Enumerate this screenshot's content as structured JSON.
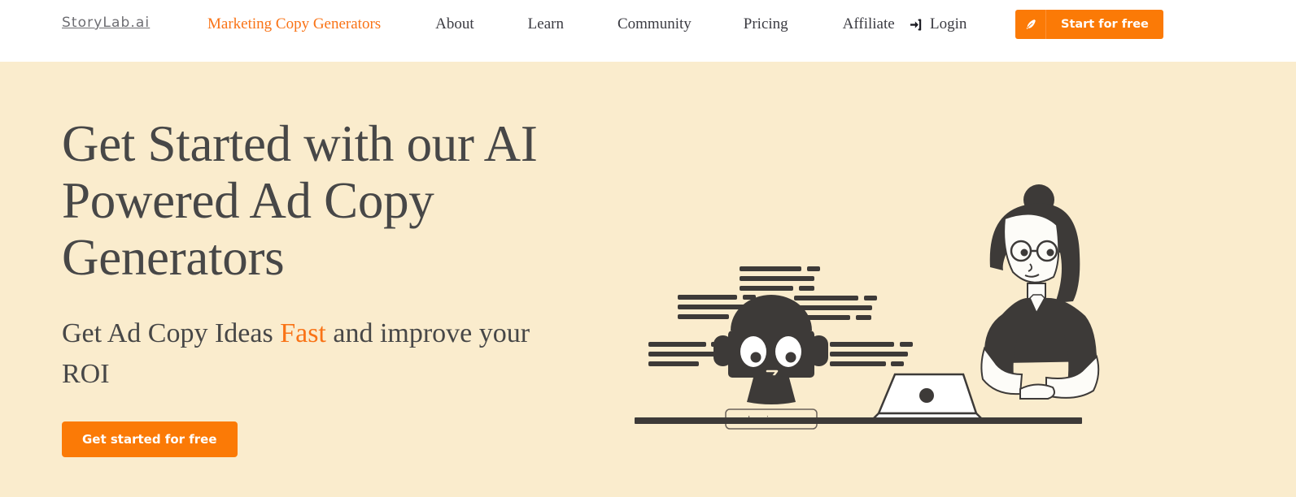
{
  "brand": {
    "logo_text": "StoryLab.ai",
    "accent_color": "#f97316",
    "button_color": "#fb7a06",
    "hero_bg_color": "#faeccd",
    "nav_bg_color": "#ffffff",
    "ink_color": "#474747"
  },
  "nav": {
    "items": [
      {
        "label": "Marketing Copy Generators",
        "active": true
      },
      {
        "label": "About",
        "active": false
      },
      {
        "label": "Learn",
        "active": false
      },
      {
        "label": "Community",
        "active": false
      },
      {
        "label": "Pricing",
        "active": false
      },
      {
        "label": "Affiliate",
        "active": false
      }
    ],
    "login_label": "Login",
    "login_icon": "sign-in-arrow-icon",
    "cta_label": "Start for free",
    "cta_icon": "pen-quill-icon"
  },
  "hero": {
    "title": "Get Started with our AI Powered Ad Copy Generators",
    "subtitle_before": "Get Ad Copy Ideas ",
    "subtitle_highlight": "Fast",
    "subtitle_after": " and improve your ROI",
    "cta_label": "Get started for free"
  },
  "illustration": {
    "name": "ai-robot-and-writer-illustration",
    "robot_button_label": "Inspire me",
    "robot_color": "#3d3a38",
    "laptop_color": "#ffffff",
    "desk_color": "#3d3a38",
    "text_line_color": "#3d3a38",
    "text_line_groups": 5,
    "figure": "woman-typing-on-laptop"
  }
}
